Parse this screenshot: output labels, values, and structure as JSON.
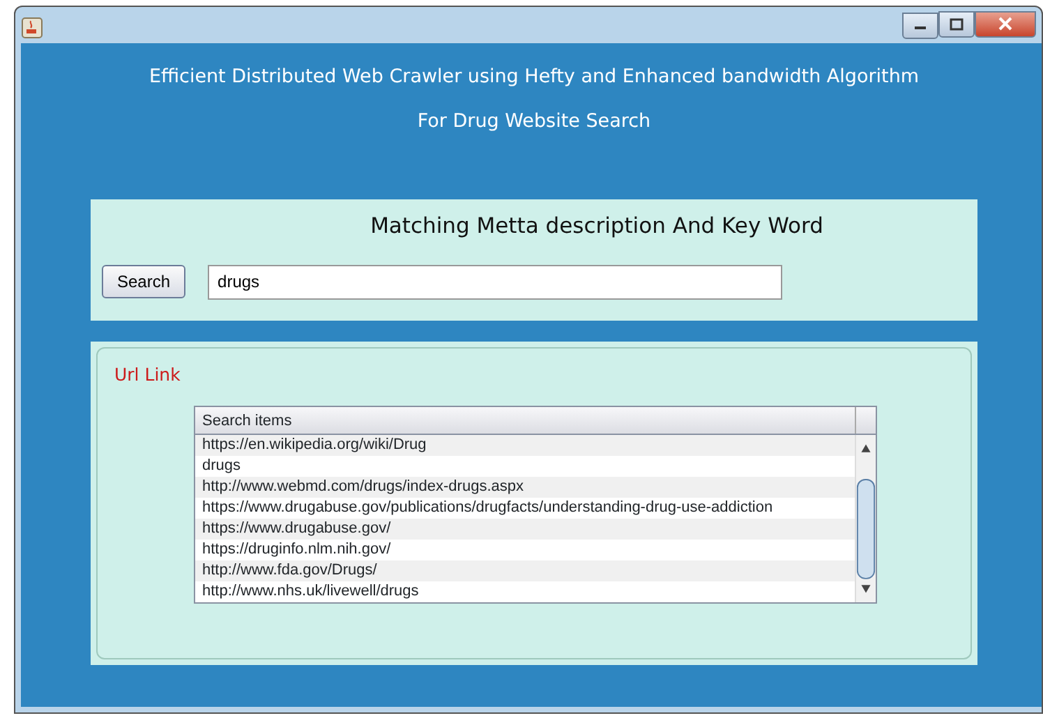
{
  "heading": [
    "Efficient Distributed Web Crawler using Hefty and Enhanced bandwidth Algorithm",
    "For Drug Website Search"
  ],
  "search_panel": {
    "title": "Matching Metta description And Key Word",
    "button": "Search",
    "value": "drugs"
  },
  "results_panel": {
    "label": "Url Link",
    "table": {
      "columns": [
        "Search items"
      ],
      "rows": [
        "https://en.wikipedia.org/wiki/Drug",
        "drugs",
        "http://www.webmd.com/drugs/index-drugs.aspx",
        "https://www.drugabuse.gov/publications/drugfacts/understanding-drug-use-addiction",
        "https://www.drugabuse.gov/",
        "https://druginfo.nlm.nih.gov/",
        "http://www.fda.gov/Drugs/",
        "http://www.nhs.uk/livewell/drugs"
      ]
    }
  }
}
